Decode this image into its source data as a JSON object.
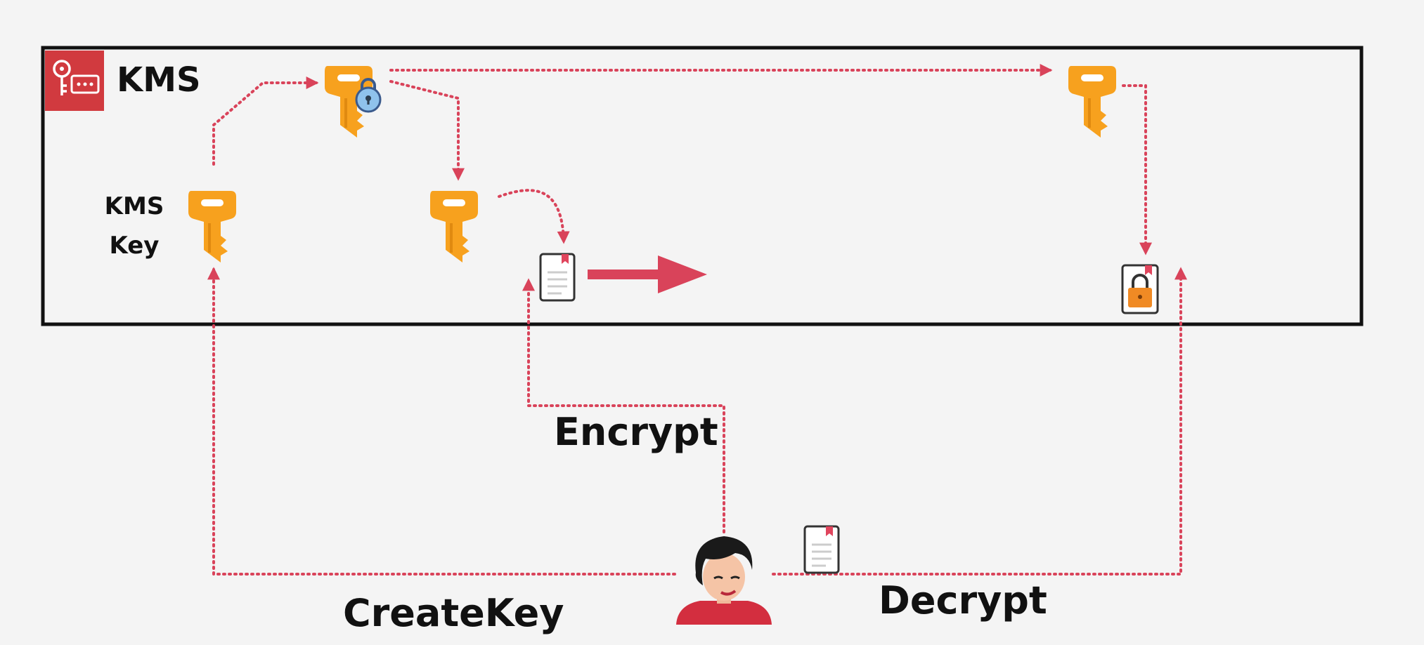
{
  "service": {
    "title": "KMS",
    "icon": "kms-service-icon",
    "brand_color": "#d13a3f"
  },
  "labels": {
    "kms_key_line1": "KMS",
    "kms_key_line2": "Key"
  },
  "operations": {
    "encrypt": "Encrypt",
    "create_key": "CreateKey",
    "decrypt": "Decrypt"
  },
  "colors": {
    "key_orange": "#f7a11e",
    "flow_red": "#d9435a",
    "box_border": "#111111",
    "background": "#f4f4f4"
  },
  "icons": [
    "key-icon",
    "lock-icon",
    "document-icon",
    "encrypted-document-icon",
    "user-avatar-icon",
    "arrow-right-icon"
  ]
}
